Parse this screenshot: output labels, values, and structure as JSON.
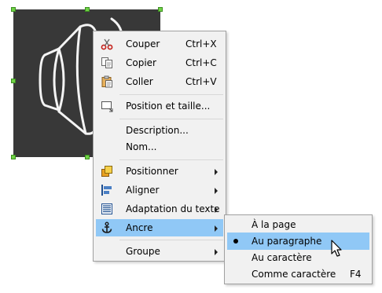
{
  "context_menu": {
    "items": [
      {
        "label": "Couper",
        "shortcut": "Ctrl+X",
        "icon": "scissors-icon"
      },
      {
        "label": "Copier",
        "shortcut": "Ctrl+C",
        "icon": "copy-icon"
      },
      {
        "label": "Coller",
        "shortcut": "Ctrl+V",
        "icon": "paste-icon"
      },
      {
        "label": "Position et taille...",
        "icon": "position-size-icon"
      },
      {
        "label": "Description..."
      },
      {
        "label": "Nom..."
      },
      {
        "label": "Positionner",
        "icon": "arrange-icon",
        "submenu": true
      },
      {
        "label": "Aligner",
        "icon": "align-icon",
        "submenu": true
      },
      {
        "label": "Adaptation du texte",
        "icon": "text-wrap-icon",
        "submenu": true
      },
      {
        "label": "Ancre",
        "icon": "anchor-icon",
        "submenu": true,
        "highlighted": true
      },
      {
        "label": "Groupe",
        "submenu": true
      }
    ]
  },
  "anchor_submenu": {
    "items": [
      {
        "label": "À la page"
      },
      {
        "label": "Au paragraphe",
        "selected": true,
        "highlighted": true
      },
      {
        "label": "Au caractère"
      },
      {
        "label": "Comme caractère",
        "shortcut": "F4"
      }
    ]
  },
  "colors": {
    "image_background": "#383838",
    "handle": "#6fd245",
    "menu_background": "#f1f1f1",
    "highlight": "#90c8f6"
  }
}
